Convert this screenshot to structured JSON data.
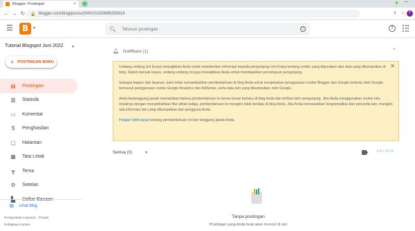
{
  "browser": {
    "tab_title": "Blogger: Postingan",
    "tab_close": "×",
    "new_tab": "+",
    "url": "blogger.com/blog/posts/2040/20150896259818",
    "profile_initial": "T",
    "minimize": "—"
  },
  "header": {
    "search_placeholder": "Telusuri postingan"
  },
  "sidebar": {
    "blog_title": "Tutorial Blogspot Juni 2022",
    "new_post_label": "POSTINGAN BARU",
    "items": [
      {
        "label": "Postingan",
        "icon": "posts-icon",
        "active": true
      },
      {
        "label": "Statistik",
        "icon": "stats-icon",
        "active": false
      },
      {
        "label": "Komentar",
        "icon": "comments-icon",
        "active": false
      },
      {
        "label": "Penghasilan",
        "icon": "earnings-icon",
        "active": false
      },
      {
        "label": "Halaman",
        "icon": "pages-icon",
        "active": false
      },
      {
        "label": "Tata Letak",
        "icon": "layout-icon",
        "active": false
      },
      {
        "label": "Tema",
        "icon": "theme-icon",
        "active": false
      },
      {
        "label": "Setelan",
        "icon": "settings-icon",
        "active": false
      },
      {
        "label": "Daftar Bacaan",
        "icon": "reading-list-icon",
        "active": false
      }
    ],
    "view_blog": "Lihat blog",
    "footer_links": [
      "Persyaratan Layanan",
      "Privasi",
      "Kebijakan Konten"
    ],
    "footer_sep": "·"
  },
  "main": {
    "notifications_label": "Notifikasi (1)",
    "notice_paragraphs": [
      "Undang-undang Uni Eropa mewajibkan Anda untuk memberikan informasi kepada pengunjung Uni Eropa tentang cookie yang digunakan dan data yang dikumpulkan di blog. Dalam banyak kasus, undang-undang ini juga mewajibkan Anda untuk mendapatkan persetujuan pengunjung.",
      "Sebagai bagian dari layanan, kami telah menambahkan pemberitahuan di blog Anda untuk menjelaskan penggunaan cookie Blogger dan Google tertentu oleh Google, termasuk penggunaan cookie Google Analytics dan AdSense, serta data lain yang dikumpulkan oleh Google.",
      "Anda bertanggung jawab memastikan bahwa pemberitahuan ini benar-benar berlaku di blog Anda dan terlihat oleh pengunjung. Jika Anda menggunakan cookie lain, misalnya dengan menambahkan fitur pihak ketiga, pemberitahuan ini mungkin tidak berlaku di blog Anda. Jika Anda memasukkan fungsionalitas dari penyedia lain, mungkin ada informasi lain yang dikumpulkan dari pengguna Anda."
    ],
    "learn_more": "Pelajari lebih lanjut",
    "learn_more_rest": " tentang pemberitahuan ini dan tanggung jawab Anda.",
    "filter_label": "Semua (0)",
    "manage_label": "KELOLA",
    "empty_title": "Tanpa postingan",
    "empty_subtitle": "Postingan yang Anda buat akan muncul di sini"
  },
  "colors": {
    "brand": "#f57c00",
    "active_bg": "#fce8e6",
    "notice_bg": "#fdf0c4",
    "link": "#1a73e8"
  }
}
